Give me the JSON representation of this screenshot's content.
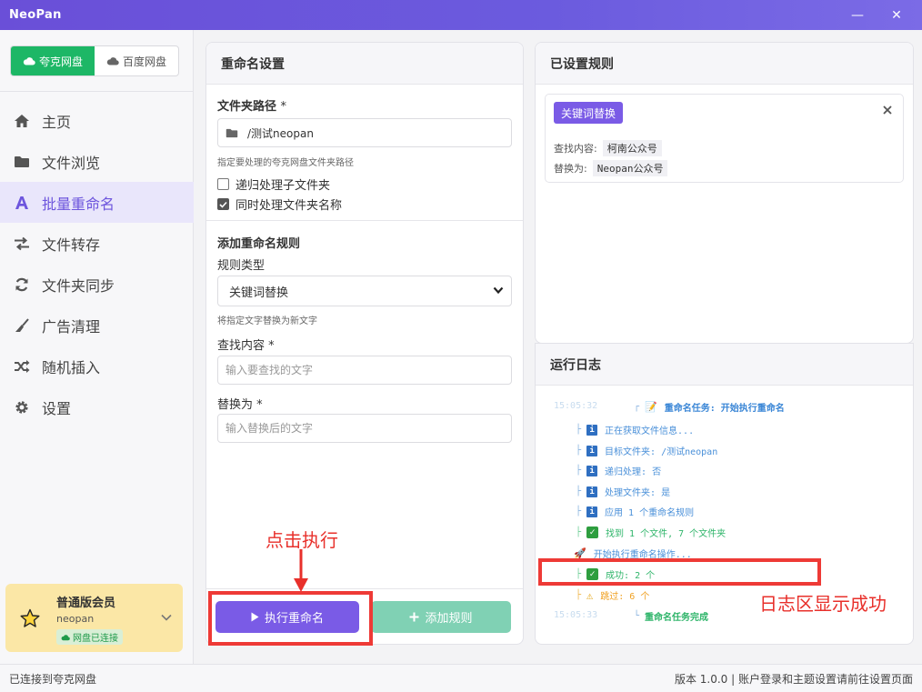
{
  "window": {
    "title": "NeoPan",
    "minimize": "—",
    "close": "✕"
  },
  "sidebar": {
    "disk_tabs": [
      {
        "label": "夸克网盘",
        "active": true
      },
      {
        "label": "百度网盘",
        "active": false
      }
    ],
    "nav": [
      {
        "label": "主页",
        "icon": "home-icon"
      },
      {
        "label": "文件浏览",
        "icon": "folder-icon"
      },
      {
        "label": "批量重命名",
        "icon": "font-icon",
        "active": true
      },
      {
        "label": "文件转存",
        "icon": "exchange-icon"
      },
      {
        "label": "文件夹同步",
        "icon": "sync-icon"
      },
      {
        "label": "广告清理",
        "icon": "broom-icon"
      },
      {
        "label": "随机插入",
        "icon": "shuffle-icon"
      },
      {
        "label": "设置",
        "icon": "gear-icon"
      }
    ],
    "member": {
      "title": "普通版会员",
      "user": "neopan",
      "badge": "网盘已连接"
    }
  },
  "rename": {
    "title": "重命名设置",
    "folder_label": "文件夹路径",
    "required_mark": "*",
    "folder_value": "/测试neopan",
    "folder_hint": "指定要处理的夸克网盘文件夹路径",
    "recursive_label": "递归处理子文件夹",
    "recursive_checked": false,
    "include_folders_label": "同时处理文件夹名称",
    "include_folders_checked": true,
    "add_rule_title": "添加重命名规则",
    "rule_type_label": "规则类型",
    "rule_type_value": "关键词替换",
    "rule_type_hint": "将指定文字替换为新文字",
    "find_label": "查找内容",
    "find_placeholder": "输入要查找的文字",
    "replace_label": "替换为",
    "replace_placeholder": "输入替换后的文字",
    "exec_button": "执行重命名",
    "add_button": "添加规则"
  },
  "rules": {
    "title": "已设置规则",
    "items": [
      {
        "tag": "关键词替换",
        "find_label": "查找内容:",
        "find_value": "柯南公众号",
        "replace_label": "替换为:",
        "replace_value": "Neopan公众号"
      }
    ]
  },
  "log": {
    "title": "运行日志",
    "faded_time_1": "15:05:32",
    "faded_time_2": "15:05:33",
    "lines": [
      {
        "branch": "┌",
        "text": "重命名任务: 开始执行重命名",
        "icon": "📝"
      },
      {
        "branch": "├",
        "text": "正在获取文件信息...",
        "icon": "i"
      },
      {
        "branch": "├",
        "text": "目标文件夹: /测试neopan",
        "icon": "i"
      },
      {
        "branch": "├",
        "text": "递归处理: 否",
        "icon": "i"
      },
      {
        "branch": "├",
        "text": "处理文件夹: 是",
        "icon": "i"
      },
      {
        "branch": "├",
        "text": "应用 1 个重命名规则",
        "icon": "i"
      },
      {
        "branch": "├",
        "text": "找到 1 个文件, 7 个文件夹",
        "icon": "✓"
      },
      {
        "branch": "",
        "text": "开始执行重命名操作...",
        "icon": "🚀"
      },
      {
        "branch": "├",
        "text": "成功: 2 个",
        "icon": "✓"
      },
      {
        "branch": "├",
        "text": "跳过: 6 个",
        "icon": "⚠"
      },
      {
        "branch": "└",
        "text": "重命名任务完成",
        "icon": ""
      }
    ]
  },
  "annotations": {
    "click_text": "点击执行",
    "log_text": "日志区显示成功"
  },
  "status": {
    "left": "已连接到夸克网盘",
    "right": "版本 1.0.0 | 账户登录和主题设置请前往设置页面"
  }
}
